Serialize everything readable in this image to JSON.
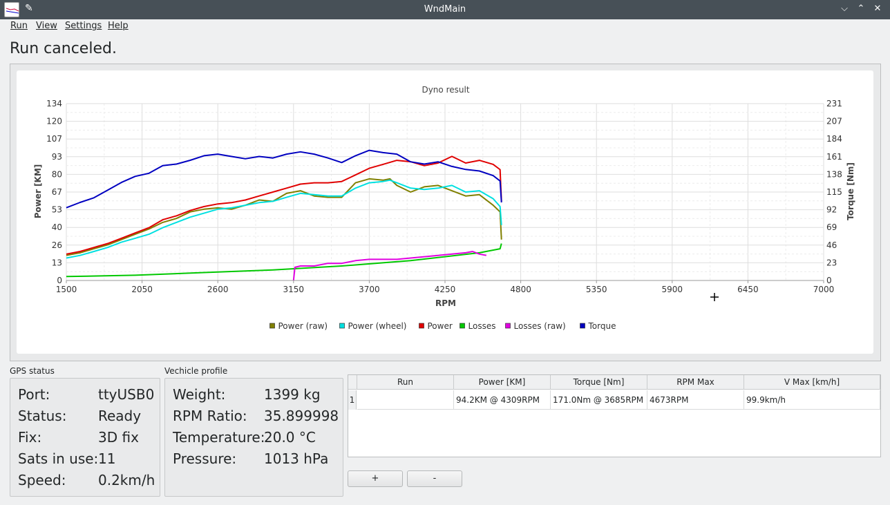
{
  "window": {
    "title": "WndMain"
  },
  "menu": [
    "Run",
    "View",
    "Settings",
    "Help"
  ],
  "status_text": "Run canceled.",
  "chart_data": {
    "type": "line",
    "title": "Dyno result",
    "xlabel": "RPM",
    "ylabel": "Power [KM]",
    "y2label": "Torque [Nm]",
    "xlim": [
      1500,
      7000
    ],
    "ylim": [
      0,
      134
    ],
    "y2lim": [
      0,
      231
    ],
    "x_ticks": [
      "1500",
      "2050",
      "2600",
      "3150",
      "3700",
      "4250",
      "4800",
      "5350",
      "5900",
      "6450",
      "7000"
    ],
    "y_ticks": [
      "0",
      "13",
      "26",
      "40",
      "53",
      "67",
      "80",
      "93",
      "107",
      "120",
      "134"
    ],
    "y2_ticks": [
      "0",
      "23",
      "46",
      "69",
      "92",
      "115",
      "138",
      "161",
      "184",
      "207",
      "231"
    ],
    "grid": true,
    "legend_position": "bottom",
    "series": [
      {
        "name": "Power (raw)",
        "color": "#808000",
        "axis": "left",
        "x": [
          1500,
          1600,
          1700,
          1800,
          1900,
          2000,
          2100,
          2200,
          2300,
          2400,
          2500,
          2600,
          2700,
          2800,
          2900,
          3000,
          3100,
          3200,
          3300,
          3400,
          3500,
          3600,
          3700,
          3800,
          3850,
          3900,
          4000,
          4100,
          4200,
          4300,
          4400,
          4500,
          4600,
          4650,
          4660
        ],
        "y": [
          19,
          21,
          24,
          27,
          31,
          35,
          39,
          44,
          47,
          52,
          54,
          55,
          54,
          57,
          61,
          60,
          66,
          68,
          64,
          63,
          63,
          74,
          77,
          76,
          77,
          72,
          67,
          71,
          72,
          68,
          64,
          65,
          57,
          52,
          31
        ]
      },
      {
        "name": "Power (wheel)",
        "color": "#00e0e0",
        "axis": "left",
        "x": [
          1500,
          1600,
          1700,
          1800,
          1900,
          2000,
          2100,
          2200,
          2300,
          2400,
          2500,
          2600,
          2700,
          2800,
          2900,
          3000,
          3100,
          3200,
          3300,
          3400,
          3500,
          3600,
          3700,
          3800,
          3850,
          3900,
          4000,
          4100,
          4200,
          4300,
          4400,
          4500,
          4600,
          4650,
          4660
        ],
        "y": [
          17,
          19,
          22,
          25,
          29,
          32,
          35,
          40,
          44,
          48,
          51,
          54,
          55,
          57,
          59,
          60,
          63,
          66,
          65,
          64,
          64,
          70,
          74,
          75,
          76,
          74,
          70,
          69,
          70,
          72,
          67,
          68,
          62,
          56,
          42
        ]
      },
      {
        "name": "Power",
        "color": "#e00000",
        "axis": "left",
        "x": [
          1500,
          1600,
          1700,
          1800,
          1900,
          2000,
          2100,
          2200,
          2300,
          2400,
          2500,
          2600,
          2700,
          2800,
          2900,
          3000,
          3100,
          3200,
          3300,
          3400,
          3500,
          3600,
          3700,
          3800,
          3900,
          4000,
          4100,
          4200,
          4300,
          4400,
          4500,
          4600,
          4650,
          4660
        ],
        "y": [
          20,
          22,
          25,
          28,
          32,
          36,
          40,
          46,
          49,
          53,
          56,
          58,
          59,
          61,
          64,
          67,
          70,
          73,
          74,
          74,
          75,
          80,
          85,
          88,
          91,
          90,
          87,
          89,
          94,
          89,
          91,
          88,
          84,
          60
        ]
      },
      {
        "name": "Losses",
        "color": "#00c800",
        "axis": "left",
        "x": [
          1500,
          2000,
          2500,
          3000,
          3500,
          4000,
          4500,
          4650,
          4660
        ],
        "y": [
          3,
          4,
          6,
          8,
          11,
          15,
          21,
          24,
          28
        ]
      },
      {
        "name": "Losses (raw)",
        "color": "#e000e0",
        "axis": "left",
        "x": [
          3150,
          3160,
          3200,
          3300,
          3400,
          3500,
          3600,
          3700,
          3800,
          3900,
          4000,
          4100,
          4200,
          4300,
          4400,
          4450,
          4500,
          4550
        ],
        "y": [
          0,
          10,
          11,
          11,
          13,
          13,
          15,
          16,
          16,
          16,
          17,
          18,
          19,
          20,
          21,
          22,
          20,
          19
        ]
      },
      {
        "name": "Torque",
        "color": "#0000c0",
        "axis": "right",
        "x": [
          1500,
          1600,
          1700,
          1800,
          1900,
          2000,
          2100,
          2200,
          2300,
          2400,
          2500,
          2600,
          2700,
          2800,
          2900,
          3000,
          3100,
          3200,
          3300,
          3400,
          3500,
          3600,
          3700,
          3800,
          3900,
          4000,
          4100,
          4200,
          4300,
          4400,
          4500,
          4600,
          4650,
          4660
        ],
        "y": [
          95,
          102,
          108,
          118,
          128,
          136,
          140,
          150,
          152,
          157,
          163,
          165,
          162,
          159,
          162,
          160,
          165,
          168,
          165,
          160,
          154,
          163,
          170,
          167,
          165,
          155,
          152,
          155,
          149,
          145,
          143,
          137,
          130,
          102
        ]
      }
    ]
  },
  "gps": {
    "title": "GPS status",
    "rows": [
      {
        "label": "Port:",
        "value": "ttyUSB0"
      },
      {
        "label": "Status:",
        "value": "Ready"
      },
      {
        "label": "Fix:",
        "value": "3D fix"
      },
      {
        "label": "Sats in use:",
        "value": "11"
      },
      {
        "label": "Speed:",
        "value": "0.2km/h"
      }
    ]
  },
  "profile": {
    "title": "Vechicle profile",
    "rows": [
      {
        "label": "Weight:",
        "value": "1399 kg"
      },
      {
        "label": "RPM Ratio:",
        "value": "35.899998"
      },
      {
        "label": "Temperature:",
        "value": "20.0 °C"
      },
      {
        "label": "Pressure:",
        "value": "1013 hPa"
      }
    ]
  },
  "runs_table": {
    "columns": [
      "Run",
      "Power [KM]",
      "Torque [Nm]",
      "RPM Max",
      "V Max [km/h]"
    ],
    "rows": [
      {
        "index": "1",
        "cells": [
          "",
          "94.2KM @ 4309RPM",
          "171.0Nm @ 3685RPM",
          "4673RPM",
          "99.9km/h"
        ]
      }
    ]
  },
  "buttons": {
    "add": "+",
    "remove": "-"
  }
}
